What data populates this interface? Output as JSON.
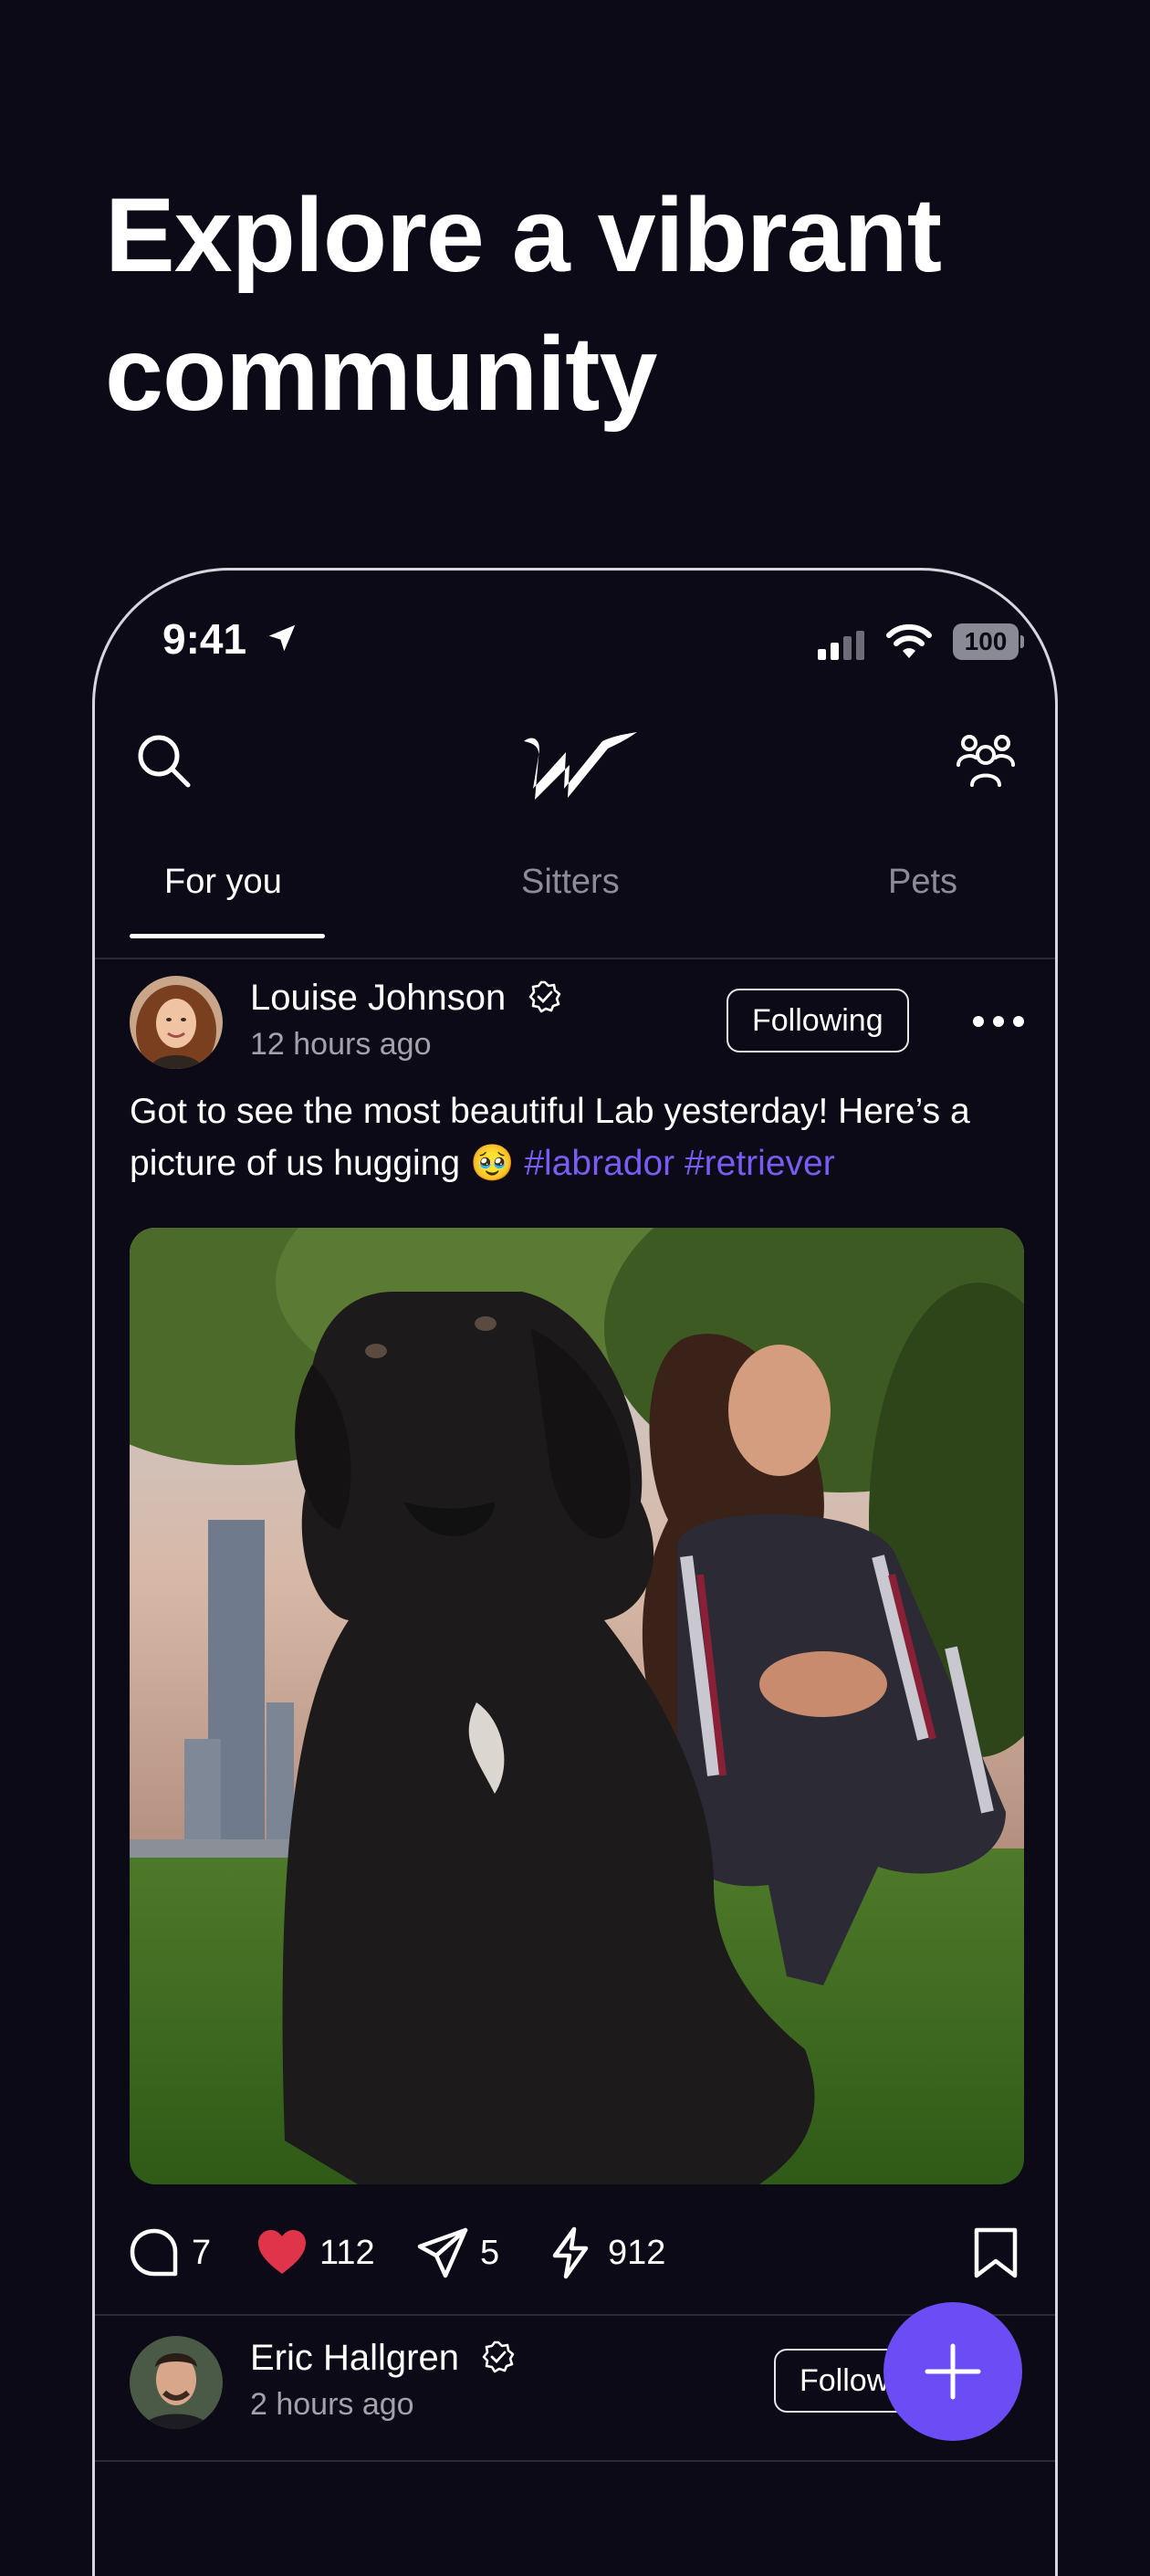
{
  "headline": {
    "line1": "Explore a vibrant",
    "line2": "community"
  },
  "status_bar": {
    "time": "9:41",
    "battery": "100"
  },
  "tabs": [
    {
      "label": "For you",
      "active": true
    },
    {
      "label": "Sitters",
      "active": false
    },
    {
      "label": "Pets",
      "active": false
    }
  ],
  "posts": [
    {
      "author": "Louise Johnson",
      "time": "12 hours ago",
      "follow_label": "Following",
      "text": "Got to see the most beautiful Lab yesterday! Here’s a picture of us hugging",
      "emoji": "🥹",
      "hashtags": [
        "#labrador",
        "#retriever"
      ],
      "comments": "7",
      "likes": "112",
      "shares": "5",
      "boosts": "912"
    },
    {
      "author": "Eric Hallgren",
      "time": "2 hours ago",
      "follow_label": "Follow"
    }
  ],
  "colors": {
    "background": "#0b0a16",
    "accent": "#6c4df5",
    "hashtag": "#7a5cf5",
    "like": "#e0344b"
  },
  "icons": [
    "location-arrow-icon",
    "signal-icon",
    "wifi-icon",
    "battery-icon",
    "search-icon",
    "app-logo",
    "community-icon",
    "verified-icon",
    "more-icon",
    "comment-icon",
    "heart-icon",
    "share-icon",
    "bolt-icon",
    "bookmark-icon",
    "plus-icon"
  ]
}
